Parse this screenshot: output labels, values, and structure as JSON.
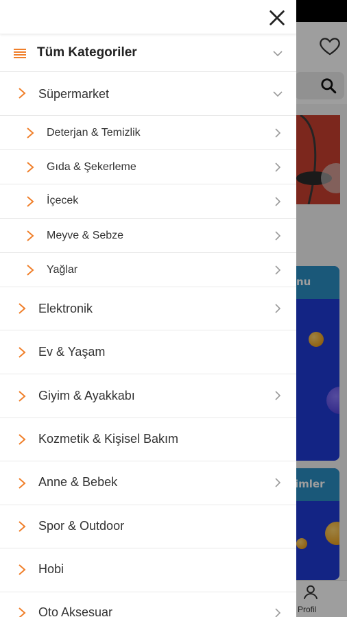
{
  "background": {
    "banner_caption_1": "nu",
    "banner_caption_2": "imler",
    "tab_profile_label": "Profil"
  },
  "drawer": {
    "header": {
      "title": "Tüm Kategoriler"
    },
    "categories": [
      {
        "label": "Süpermarket",
        "expanded": true,
        "has_arrow": true,
        "children": [
          {
            "label": "Deterjan & Temizlik"
          },
          {
            "label": "Gıda & Şekerleme"
          },
          {
            "label": "İçecek"
          },
          {
            "label": "Meyve & Sebze"
          },
          {
            "label": "Yağlar"
          }
        ]
      },
      {
        "label": "Elektronik",
        "has_arrow": true
      },
      {
        "label": "Ev & Yaşam",
        "has_arrow": false
      },
      {
        "label": "Giyim & Ayakkabı",
        "has_arrow": true
      },
      {
        "label": "Kozmetik & Kişisel Bakım",
        "has_arrow": false
      },
      {
        "label": "Anne & Bebek",
        "has_arrow": true
      },
      {
        "label": "Spor & Outdoor",
        "has_arrow": false
      },
      {
        "label": "Hobi",
        "has_arrow": false
      },
      {
        "label": "Oto Aksesuar",
        "has_arrow": true
      }
    ]
  },
  "colors": {
    "accent": "#f07f2a",
    "chevron_gray": "#9a9a9a"
  }
}
